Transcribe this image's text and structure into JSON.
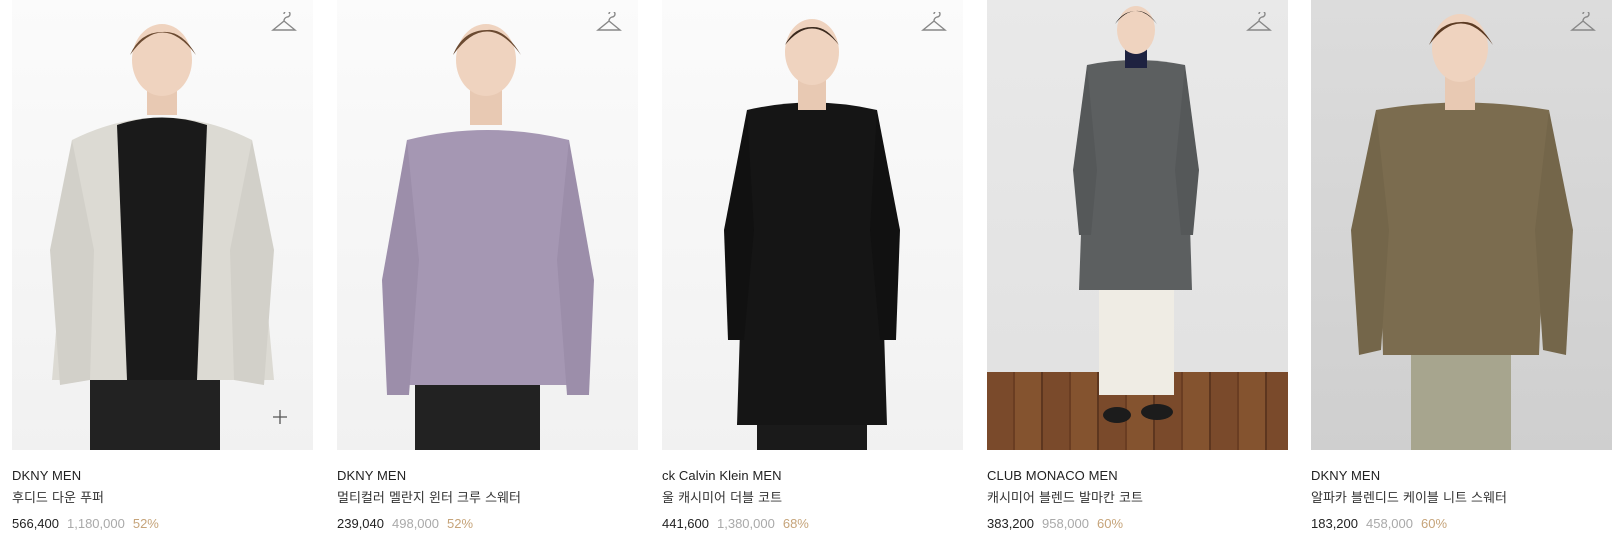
{
  "products": [
    {
      "brand": "DKNY MEN",
      "name": "후디드 다운 푸퍼",
      "price": "566,400",
      "original_price": "1,180,000",
      "discount": "52%",
      "wishlist_icon": "hanger-icon",
      "add_icon": "plus-icon"
    },
    {
      "brand": "DKNY MEN",
      "name": "멀티컬러 멜란지 윈터 크루 스웨터",
      "price": "239,040",
      "original_price": "498,000",
      "discount": "52%",
      "wishlist_icon": "hanger-icon"
    },
    {
      "brand": "ck Calvin Klein MEN",
      "name": "울 캐시미어 더블 코트",
      "price": "441,600",
      "original_price": "1,380,000",
      "discount": "68%",
      "wishlist_icon": "hanger-icon"
    },
    {
      "brand": "CLUB MONACO MEN",
      "name": "캐시미어 블렌드 발마칸 코트",
      "price": "383,200",
      "original_price": "958,000",
      "discount": "60%",
      "wishlist_icon": "hanger-icon"
    },
    {
      "brand": "DKNY MEN",
      "name": "알파카 블렌디드 케이블 니트 스웨터",
      "price": "183,200",
      "original_price": "458,000",
      "discount": "60%",
      "wishlist_icon": "hanger-icon"
    }
  ],
  "colors": {
    "price": "#222222",
    "original_price": "#a9a9a9",
    "discount": "#c6a47a"
  }
}
